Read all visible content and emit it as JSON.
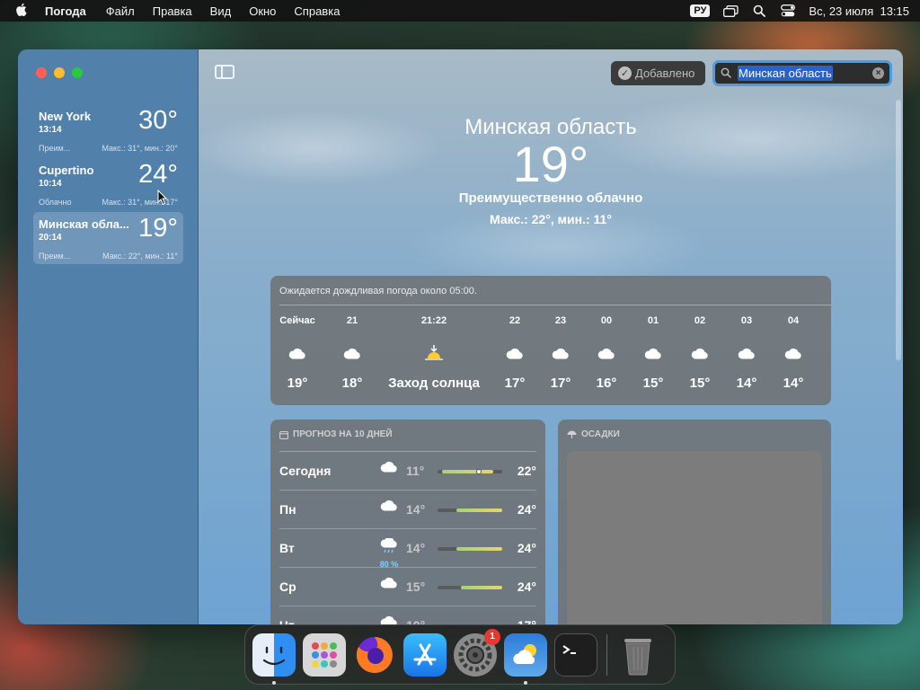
{
  "menubar": {
    "app_name": "Погода",
    "menus": [
      "Файл",
      "Правка",
      "Вид",
      "Окно",
      "Справка"
    ],
    "input_lang": "РУ",
    "datetime": "Вс, 23 июля  13:15"
  },
  "sidebar": {
    "locations": [
      {
        "city": "New York",
        "time": "13:14",
        "temp": "30°",
        "condition": "Преим...",
        "hilo": "Макс.: 31°, мин.: 20°",
        "selected": false
      },
      {
        "city": "Cupertino",
        "time": "10:14",
        "temp": "24°",
        "condition": "Облачно",
        "hilo": "Макс.: 31°, мин.: 17°",
        "selected": false
      },
      {
        "city": "Минская обла...",
        "time": "20:14",
        "temp": "19°",
        "condition": "Преим...",
        "hilo": "Макс.: 22°, мин.: 11°",
        "selected": true
      }
    ]
  },
  "toolbar": {
    "added_label": "Добавлено",
    "search_value": "Минская область"
  },
  "current": {
    "city": "Минская область",
    "temp": "19°",
    "condition": "Преимущественно облачно",
    "hilo": "Макс.: 22°, мин.: 11°"
  },
  "hourly": {
    "summary": "Ожидается дождливая погода около 05:00.",
    "hours": [
      {
        "label": "Сейчас",
        "icon": "cloud-icon",
        "temp": "19°"
      },
      {
        "label": "21",
        "icon": "cloud-icon",
        "temp": "18°"
      },
      {
        "label": "21:22",
        "icon": "sunset-icon",
        "temp": "Заход солнца"
      },
      {
        "label": "22",
        "icon": "cloud-icon",
        "temp": "17°"
      },
      {
        "label": "23",
        "icon": "cloud-icon",
        "temp": "17°"
      },
      {
        "label": "00",
        "icon": "cloud-icon",
        "temp": "16°"
      },
      {
        "label": "01",
        "icon": "cloud-icon",
        "temp": "15°"
      },
      {
        "label": "02",
        "icon": "cloud-icon",
        "temp": "15°"
      },
      {
        "label": "03",
        "icon": "cloud-icon",
        "temp": "14°"
      },
      {
        "label": "04",
        "icon": "cloud-icon",
        "temp": "14°"
      }
    ]
  },
  "forecast": {
    "title": "ПРОГНОЗ НА 10 ДНЕЙ",
    "days": [
      {
        "day": "Сегодня",
        "icon": "cloud-icon",
        "precip": "",
        "low": "11°",
        "high": "22°"
      },
      {
        "day": "Пн",
        "icon": "cloud-icon",
        "precip": "",
        "low": "14°",
        "high": "24°"
      },
      {
        "day": "Вт",
        "icon": "cloud-rain-icon",
        "precip": "80 %",
        "low": "14°",
        "high": "24°"
      },
      {
        "day": "Ср",
        "icon": "cloud-icon",
        "precip": "",
        "low": "15°",
        "high": "24°"
      },
      {
        "day": "Чт",
        "icon": "cloud-icon",
        "precip": "",
        "low": "10°",
        "high": "17°"
      }
    ]
  },
  "precipitation": {
    "title": "ОСАДКИ"
  },
  "dock": {
    "items": [
      "finder-icon",
      "launchpad-icon",
      "firefox-icon",
      "app-store-icon",
      "system-settings-icon",
      "weather-icon",
      "terminal-icon",
      "trash-icon"
    ],
    "settings_badge": "1"
  }
}
